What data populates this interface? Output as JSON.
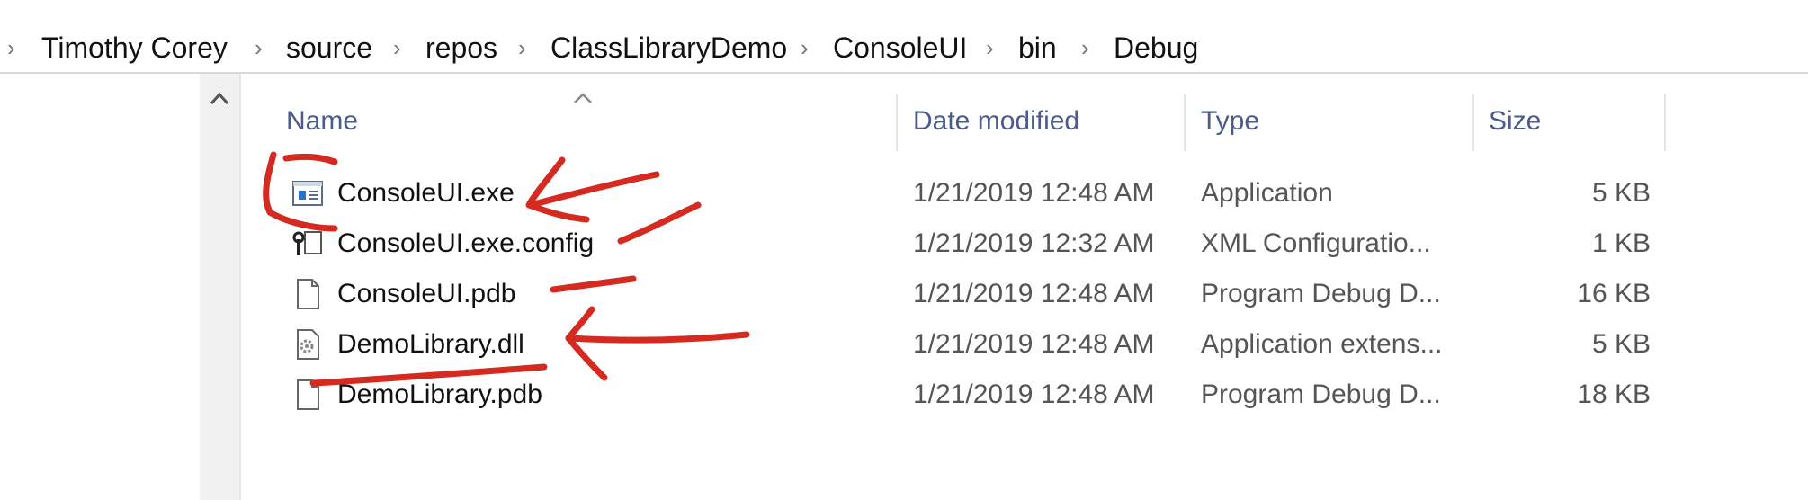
{
  "breadcrumb": {
    "items": [
      "Timothy Corey",
      "source",
      "repos",
      "ClassLibraryDemo",
      "ConsoleUI",
      "bin",
      "Debug"
    ],
    "separator": "›"
  },
  "columns": {
    "name": "Name",
    "date": "Date modified",
    "type": "Type",
    "size": "Size"
  },
  "files": [
    {
      "name": "ConsoleUI.exe",
      "date": "1/21/2019 12:48 AM",
      "type": "Application",
      "size": "5 KB",
      "icon": "application-icon"
    },
    {
      "name": "ConsoleUI.exe.config",
      "date": "1/21/2019 12:32 AM",
      "type": "XML Configuratio...",
      "size": "1 KB",
      "icon": "config-file-icon"
    },
    {
      "name": "ConsoleUI.pdb",
      "date": "1/21/2019 12:48 AM",
      "type": "Program Debug D...",
      "size": "16 KB",
      "icon": "blank-file-icon"
    },
    {
      "name": "DemoLibrary.dll",
      "date": "1/21/2019 12:48 AM",
      "type": "Application extens...",
      "size": "5 KB",
      "icon": "dll-file-icon"
    },
    {
      "name": "DemoLibrary.pdb",
      "date": "1/21/2019 12:48 AM",
      "type": "Program Debug D...",
      "size": "18 KB",
      "icon": "blank-file-icon"
    }
  ],
  "colors": {
    "header_text": "#4b5b8c",
    "annotation": "#d42a1f"
  }
}
